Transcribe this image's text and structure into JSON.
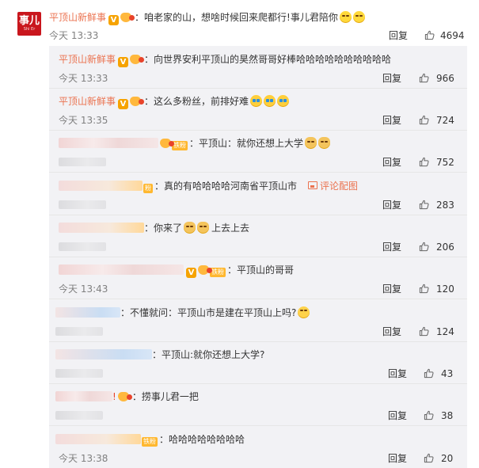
{
  "top_comment": {
    "username": "平顶山新鲜事",
    "text": "：咱老家的山，想啥时候回来爬都行!事儿君陪你",
    "time": "今天 13:33",
    "reply_label": "回复",
    "likes": "4694",
    "avatar_text": "事儿"
  },
  "replies": [
    {
      "username": "平顶山新鲜事",
      "text": "：向世界安利平顶山的昊然哥哥好棒哈哈哈哈哈哈哈哈哈哈",
      "time": "今天 13:33",
      "reply_label": "回复",
      "likes": "966"
    },
    {
      "username": "平顶山新鲜事",
      "text": "：这么多粉丝，前排好难",
      "time": "今天 13:35",
      "reply_label": "回复",
      "likes": "724"
    },
    {
      "fan_badge": "铁粉",
      "text": "：平顶山：就你还想上大学",
      "reply_label": "回复",
      "likes": "752"
    },
    {
      "fan_badge": "粉",
      "text": "：真的有哈哈哈哈河南省平顶山市",
      "review_link": "评论配图",
      "reply_label": "回复",
      "likes": "283"
    },
    {
      "text": "：你来了",
      "text_tail": "上去上去",
      "reply_label": "回复",
      "likes": "206"
    },
    {
      "fan_badge": "铁粉",
      "text": "：平顶山的哥哥",
      "time": "今天 13:43",
      "reply_label": "回复",
      "likes": "120"
    },
    {
      "text": "：不懂就问：平顶山市是建在平顶山上吗?",
      "reply_label": "回复",
      "likes": "124"
    },
    {
      "text": "：平顶山:就你还想上大学?",
      "reply_label": "回复",
      "likes": "43"
    },
    {
      "text": "：捞事儿君一把",
      "reply_label": "回复",
      "likes": "38"
    },
    {
      "fan_badge": "铁粉",
      "text": "：哈哈哈哈哈哈哈哈",
      "time": "今天 13:38",
      "reply_label": "回复",
      "likes": "20"
    }
  ],
  "colors": {
    "username": "#eb7350",
    "reply_bg": "#f2f2f5",
    "vip_badge": "#f6a300"
  }
}
